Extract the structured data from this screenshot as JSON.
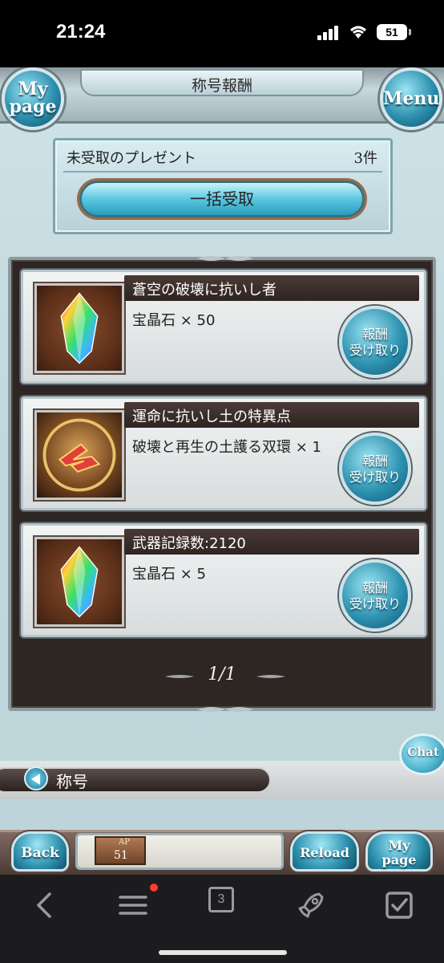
{
  "status_bar": {
    "time": "21:24",
    "battery": "51"
  },
  "header": {
    "title": "称号報酬",
    "mypage_label_line1": "My",
    "mypage_label_line2": "page",
    "menu_label": "Menu"
  },
  "unclaimed": {
    "label": "未受取のプレゼント",
    "count": "3件",
    "claim_all_label": "一括受取"
  },
  "rewards": [
    {
      "title": "蒼空の破壊に抗いし者",
      "item": "宝晶石 × 50",
      "icon": "rainbow-crystal-icon",
      "button_line1": "報酬",
      "button_line2": "受け取り"
    },
    {
      "title": "運命に抗いし土の特異点",
      "item": "破壊と再生の土護る双環 × 1",
      "icon": "twin-ring-icon",
      "button_line1": "報酬",
      "button_line2": "受け取り"
    },
    {
      "title": "武器記録数:2120",
      "item": "宝晶石 × 5",
      "icon": "rainbow-crystal-icon",
      "button_line1": "報酬",
      "button_line2": "受け取り"
    }
  ],
  "pager": "1/1",
  "chat_label": "Chat",
  "title_section": {
    "label": "称号"
  },
  "footer": {
    "back_label": "Back",
    "reload_label": "Reload",
    "mypage_line1": "My",
    "mypage_line2": "page",
    "ap_label": "AP",
    "ap_value": "51"
  },
  "browser": {
    "tab_count": "3"
  },
  "colors": {
    "accent_blue": "#2c8fae",
    "panel_dark": "#2e2623",
    "notification_red": "#ff3b30"
  }
}
